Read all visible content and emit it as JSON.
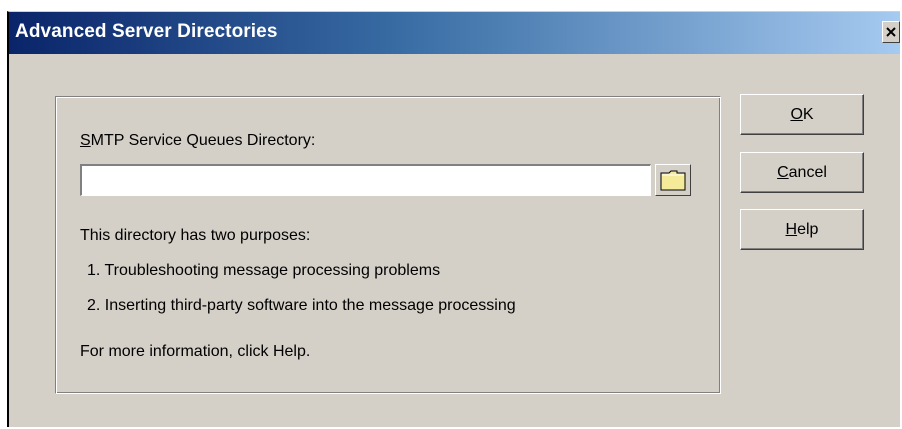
{
  "window": {
    "title": "Advanced Server Directories",
    "close_symbol": "✕"
  },
  "group": {
    "field_label_mnemonic": "S",
    "field_label_rest": "MTP Service Queues Directory:",
    "field_value": "",
    "browse_icon": "folder-icon",
    "intro": "This directory has two purposes:",
    "purpose_1": "1. Troubleshooting message processing problems",
    "purpose_2": "2. Inserting third-party software into the message processing",
    "more_info": "For more information, click Help."
  },
  "buttons": {
    "ok": {
      "mnemonic": "O",
      "rest": "K"
    },
    "cancel": {
      "mnemonic": "C",
      "rest": "ancel"
    },
    "help": {
      "mnemonic": "H",
      "rest": "elp"
    }
  },
  "colors": {
    "title_gradient_start": "#0a246a",
    "title_gradient_end": "#a6caf0",
    "dialog_face": "#d4d0c8",
    "folder": "#f5e99a"
  }
}
